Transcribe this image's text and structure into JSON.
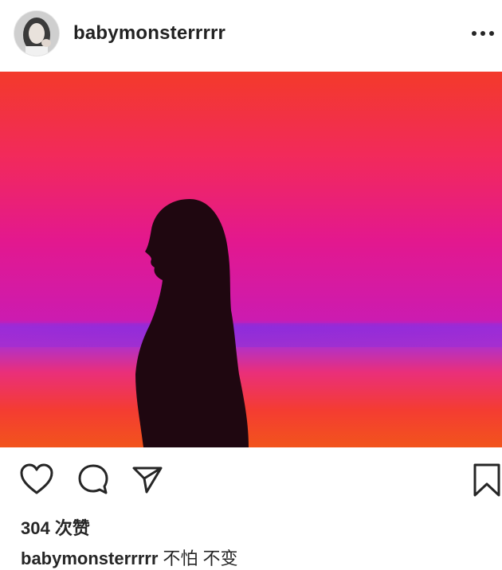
{
  "post": {
    "username": "babymonsterrrrr",
    "likes_text": "304 次赞",
    "caption": {
      "username": "babymonsterrrrr",
      "text": "不怕 不变"
    }
  },
  "icons": {
    "more": "more-options-icon",
    "like": "heart-icon",
    "comment": "comment-bubble-icon",
    "share": "paper-plane-icon",
    "save": "bookmark-icon"
  },
  "colors": {
    "photo_top": "#f23a2e",
    "photo_mid": "#e8158a",
    "photo_band": "#8a2bd6",
    "photo_bottom": "#f24b1d",
    "text": "#262626"
  }
}
